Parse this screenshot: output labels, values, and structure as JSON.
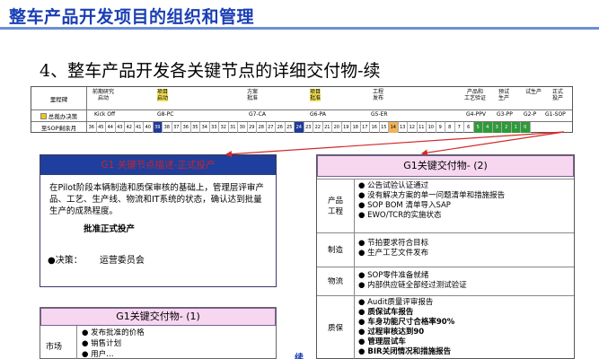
{
  "header": {
    "title": "整车产品开发项目的组织和管理",
    "subtitle": "4、整车产品开发各关键节点的详细交付物-续"
  },
  "timeline": {
    "row_labels": [
      "里程碑",
      "总裁办决策",
      "至SOP剩余月"
    ],
    "milestones": [
      {
        "label": "前期研究\n启动",
        "highlight": false
      },
      {
        "label": "项目\n启动",
        "highlight": true
      },
      {
        "label": "方案\n批准",
        "highlight": false
      },
      {
        "label": "项目\n批准",
        "highlight": true
      },
      {
        "label": "工程\n发布",
        "highlight": false
      },
      {
        "label": "产品和\n工艺验证",
        "highlight": false
      },
      {
        "label": "预试\n生产",
        "highlight": false
      },
      {
        "label": "试生产",
        "highlight": false
      },
      {
        "label": "正式\n投产",
        "highlight": false
      }
    ],
    "gates": [
      "Kick Off",
      "G8-PC",
      "G7-CA",
      "G6-PA",
      "G5-ER",
      "G4-PPV",
      "G3-PP",
      "G2-P",
      "G1-SOP"
    ],
    "months": [
      "36",
      "45",
      "44",
      "43",
      "42",
      "41",
      "40",
      "39",
      "38",
      "37",
      "36",
      "35",
      "34",
      "33",
      "32",
      "31",
      "30",
      "29",
      "28",
      "27",
      "26",
      "25",
      "24",
      "23",
      "22",
      "21",
      "20",
      "19",
      "18",
      "17",
      "16",
      "15",
      "14",
      "13",
      "12",
      "11",
      "10",
      "9",
      "8",
      "7",
      "6",
      "5",
      "4",
      "3",
      "2",
      "1",
      "0"
    ]
  },
  "left_box": {
    "title": "G1 关键节点描述-正式投产",
    "paragraph": "在Pilot阶段本辆制造和质保审核的基础上，管理层评审产品、工艺、生产线、物流和IT系统的状态，确认达到批量生产的成熟程度。",
    "bold_line": "批准正式投产",
    "decision_label": "●决策：",
    "decision_value": "运营委员会"
  },
  "right_box": {
    "title": "G1关键交付物- (2)",
    "sections": [
      {
        "label": "产品\n工程",
        "items": [
          "● 公告试验认证通过",
          "● 没有解决方案的单一问题清单和措施报告",
          "● SOP BOM 清单导入SAP",
          "● EWO/TCR的实施状态"
        ]
      },
      {
        "label": "制造",
        "items": [
          "● 节拍要求符合目标",
          "● 生产工艺文件发布"
        ]
      },
      {
        "label": "物流",
        "items": [
          "● SOP零件准备就绪",
          "● 内部供应链全部经过测试验证"
        ]
      },
      {
        "label": "质保",
        "items": [
          "● Audit质量评审报告",
          "● 质保试车报告",
          "● 车身功能尺寸合格率90%",
          "● 过程审核达到90",
          "● 管理层试车",
          "● BIR关闭情况和措施报告"
        ]
      }
    ]
  },
  "bottom_box": {
    "title": "G1关键交付物- (1)",
    "label": "市场",
    "items": [
      "● 发布批准的价格",
      "● 销售计划",
      "● 用户…"
    ]
  },
  "side_char": "续",
  "colors": {
    "title_blue": "#1a3fb5",
    "arrow_red": "#d42a2a",
    "highlight_yellow": "#f3e35a",
    "pink": "#f7d6ef"
  }
}
